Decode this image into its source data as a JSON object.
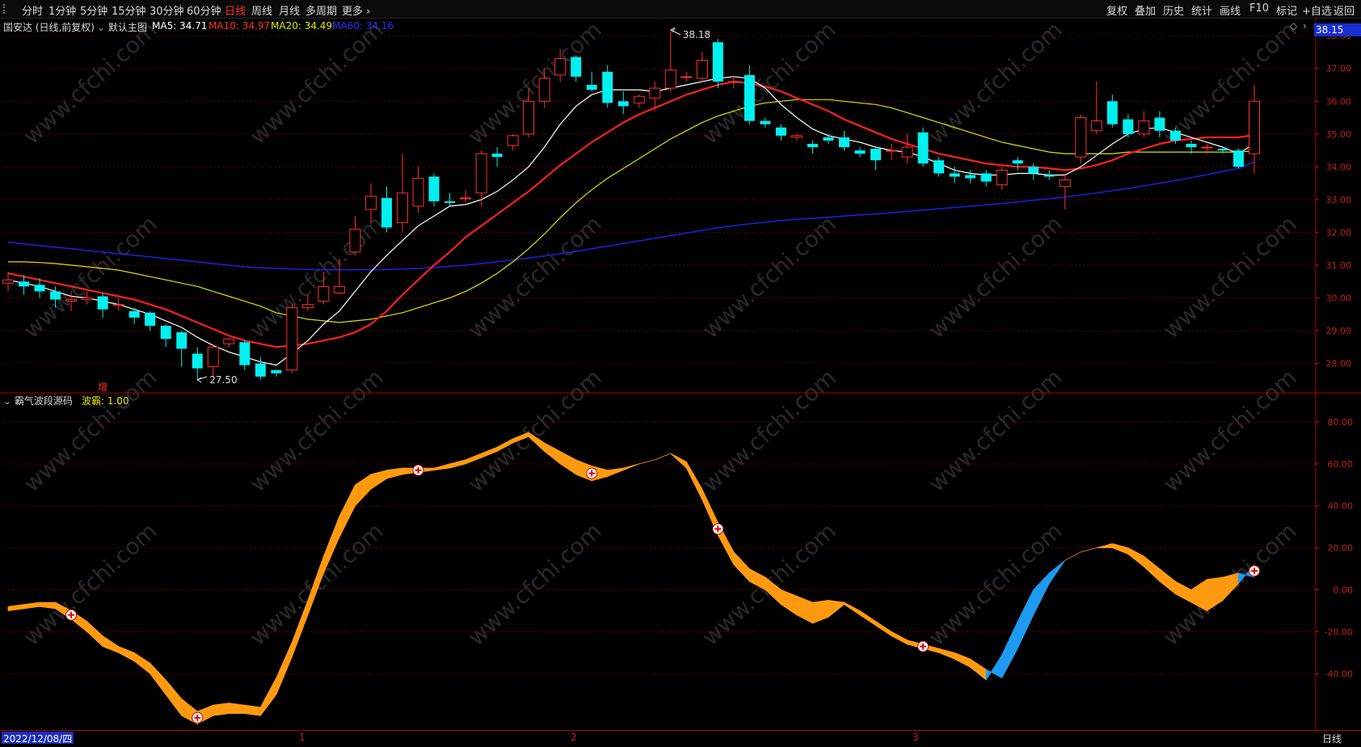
{
  "toolbar": {
    "periods": [
      "分时",
      "1分钟",
      "5分钟",
      "15分钟",
      "30分钟",
      "60分钟",
      "日线",
      "周线",
      "月线",
      "多周期",
      "更多 ›"
    ],
    "active_period": "日线",
    "right_buttons": [
      "复权",
      "叠加",
      "历史",
      "统计",
      "画线",
      "F10",
      "标记",
      "+自选",
      "返回"
    ]
  },
  "main_chart": {
    "title": "国安达 (日线,前复权)",
    "template": "默认主图",
    "ma_labels": [
      {
        "text": "MA5: 34.71",
        "color": "#ffffff"
      },
      {
        "text": "MA10: 34.97",
        "color": "#ff3030"
      },
      {
        "text": "MA20: 34.49",
        "color": "#e8e800"
      },
      {
        "text": "MA60: 34.16",
        "color": "#3030ff"
      }
    ],
    "current_price": "38.15",
    "high_mark": "38.18",
    "low_mark": "27.50",
    "marker_char": "增",
    "yaxis_ticks": [
      "38.00",
      "37.00",
      "36.00",
      "35.00",
      "34.00",
      "33.00",
      "32.00",
      "31.00",
      "30.00",
      "29.00",
      "28.00"
    ]
  },
  "sub_chart": {
    "title": "霸气波段源码",
    "value_label": "波霸: 1.00",
    "yaxis_ticks": [
      "80.00",
      "60.00",
      "40.00",
      "20.00",
      "0.00",
      "-20.00",
      "-40.00"
    ]
  },
  "bottom": {
    "date": "2022/12/08/四",
    "months": [
      "1",
      "2",
      "3"
    ],
    "period": "日线"
  },
  "watermark": "www.cfchi.com",
  "colors": {
    "up": "#ff3030",
    "down": "#00f0f0",
    "ma5": "#ffffff",
    "ma10": "#ff2020",
    "ma20": "#e0e000",
    "ma60": "#2020e0",
    "osc_up": "#ff9a10",
    "osc_down": "#1e9af0",
    "grid": "#6a0000",
    "axis": "#c02020"
  },
  "chart_data": {
    "type": "candlestick",
    "ylim": [
      27.3,
      38.3
    ],
    "candles": [
      [
        30.45,
        30.55,
        30.2,
        30.8
      ],
      [
        30.5,
        30.35,
        30.1,
        30.7
      ],
      [
        30.4,
        30.2,
        30.0,
        30.6
      ],
      [
        30.2,
        29.95,
        29.7,
        30.35
      ],
      [
        29.9,
        29.95,
        29.6,
        30.2
      ],
      [
        29.95,
        30.0,
        29.8,
        30.2
      ],
      [
        30.05,
        29.65,
        29.4,
        30.15
      ],
      [
        29.8,
        29.8,
        29.6,
        30.0
      ],
      [
        29.6,
        29.4,
        29.2,
        29.7
      ],
      [
        29.55,
        29.15,
        29.0,
        29.6
      ],
      [
        29.15,
        28.75,
        28.5,
        29.2
      ],
      [
        28.95,
        28.45,
        27.9,
        29.0
      ],
      [
        28.3,
        27.85,
        27.5,
        28.5
      ],
      [
        27.9,
        28.5,
        27.6,
        28.6
      ],
      [
        28.6,
        28.75,
        28.5,
        28.8
      ],
      [
        28.65,
        27.95,
        27.8,
        28.7
      ],
      [
        28.0,
        27.6,
        27.5,
        28.2
      ],
      [
        27.8,
        27.7,
        27.6,
        27.8
      ],
      [
        27.8,
        29.7,
        27.7,
        29.8
      ],
      [
        29.7,
        29.8,
        29.6,
        30.1
      ],
      [
        29.9,
        30.35,
        29.8,
        30.8
      ],
      [
        30.15,
        30.35,
        30.1,
        31.2
      ],
      [
        31.4,
        32.1,
        31.3,
        32.5
      ],
      [
        32.7,
        33.1,
        32.3,
        33.5
      ],
      [
        33.05,
        32.15,
        32.0,
        33.4
      ],
      [
        32.3,
        33.2,
        32.0,
        34.4
      ],
      [
        32.8,
        33.65,
        32.6,
        34.0
      ],
      [
        33.7,
        32.95,
        32.8,
        33.8
      ],
      [
        32.95,
        32.9,
        32.8,
        33.2
      ],
      [
        33.05,
        33.05,
        32.9,
        33.3
      ],
      [
        33.2,
        34.4,
        32.8,
        34.5
      ],
      [
        34.4,
        34.3,
        34.0,
        34.6
      ],
      [
        34.65,
        34.95,
        34.5,
        35.0
      ],
      [
        35.0,
        36.0,
        34.9,
        36.4
      ],
      [
        36.0,
        36.7,
        35.8,
        37.0
      ],
      [
        36.8,
        37.3,
        36.6,
        37.6
      ],
      [
        37.35,
        36.75,
        36.6,
        37.4
      ],
      [
        36.5,
        36.35,
        36.3,
        36.9
      ],
      [
        36.9,
        35.95,
        35.8,
        37.1
      ],
      [
        36.0,
        35.85,
        35.6,
        36.3
      ],
      [
        35.95,
        36.15,
        35.8,
        36.2
      ],
      [
        36.1,
        36.4,
        35.7,
        36.6
      ],
      [
        36.4,
        36.95,
        36.3,
        38.18
      ],
      [
        36.75,
        36.75,
        36.6,
        36.9
      ],
      [
        36.7,
        37.25,
        36.6,
        37.5
      ],
      [
        37.8,
        36.6,
        36.4,
        37.9
      ],
      [
        36.6,
        36.6,
        36.4,
        36.8
      ],
      [
        36.8,
        35.4,
        35.3,
        37.1
      ],
      [
        35.4,
        35.3,
        35.2,
        35.5
      ],
      [
        35.2,
        34.95,
        34.8,
        35.3
      ],
      [
        34.9,
        34.95,
        34.8,
        35.0
      ],
      [
        34.7,
        34.6,
        34.4,
        34.8
      ],
      [
        34.9,
        34.8,
        34.7,
        35.0
      ],
      [
        34.9,
        34.6,
        34.5,
        35.1
      ],
      [
        34.5,
        34.4,
        34.3,
        34.6
      ],
      [
        34.55,
        34.2,
        33.9,
        34.6
      ],
      [
        34.5,
        34.5,
        34.2,
        34.7
      ],
      [
        34.3,
        34.6,
        34.1,
        35.0
      ],
      [
        35.05,
        34.1,
        34.0,
        35.2
      ],
      [
        34.2,
        33.8,
        33.7,
        34.3
      ],
      [
        33.8,
        33.7,
        33.5,
        34.0
      ],
      [
        33.75,
        33.65,
        33.5,
        33.9
      ],
      [
        33.8,
        33.55,
        33.4,
        33.9
      ],
      [
        33.45,
        33.9,
        33.3,
        34.0
      ],
      [
        34.2,
        34.1,
        33.9,
        34.3
      ],
      [
        34.0,
        33.8,
        33.6,
        34.1
      ],
      [
        33.75,
        33.7,
        33.6,
        33.9
      ],
      [
        33.4,
        33.6,
        32.7,
        33.8
      ],
      [
        34.3,
        35.5,
        34.1,
        35.6
      ],
      [
        35.1,
        35.4,
        35.0,
        36.6
      ],
      [
        36.0,
        35.3,
        35.2,
        36.2
      ],
      [
        35.45,
        35.0,
        34.9,
        35.6
      ],
      [
        35.0,
        35.4,
        34.9,
        35.7
      ],
      [
        35.5,
        35.1,
        34.9,
        35.7
      ],
      [
        35.1,
        34.8,
        34.7,
        35.2
      ],
      [
        34.7,
        34.6,
        34.4,
        34.8
      ],
      [
        34.6,
        34.6,
        34.4,
        34.7
      ],
      [
        34.55,
        34.5,
        34.4,
        34.6
      ],
      [
        34.5,
        34.0,
        33.95,
        34.55
      ],
      [
        34.4,
        36.0,
        33.8,
        36.5
      ]
    ],
    "ma5": [
      30.55,
      30.45,
      30.35,
      30.2,
      30.05,
      30.0,
      29.9,
      29.8,
      29.65,
      29.5,
      29.3,
      29.1,
      28.8,
      28.55,
      28.35,
      28.2,
      28.05,
      27.95,
      28.3,
      28.7,
      29.2,
      29.6,
      30.2,
      30.8,
      31.3,
      31.75,
      32.2,
      32.5,
      32.8,
      32.85,
      33.0,
      33.25,
      33.6,
      34.0,
      34.6,
      35.3,
      35.85,
      36.2,
      36.35,
      36.35,
      36.35,
      36.3,
      36.4,
      36.5,
      36.6,
      36.7,
      36.75,
      36.7,
      36.4,
      35.9,
      35.5,
      35.15,
      34.95,
      34.85,
      34.75,
      34.6,
      34.5,
      34.45,
      34.3,
      34.1,
      33.9,
      33.8,
      33.75,
      33.75,
      33.8,
      33.8,
      33.75,
      33.75,
      34.0,
      34.35,
      34.7,
      35.0,
      35.15,
      35.2,
      35.05,
      34.9,
      34.75,
      34.6,
      34.4,
      34.71
    ],
    "ma10": [
      30.75,
      30.65,
      30.55,
      30.45,
      30.35,
      30.25,
      30.15,
      30.05,
      29.95,
      29.8,
      29.65,
      29.45,
      29.25,
      29.05,
      28.85,
      28.7,
      28.6,
      28.5,
      28.55,
      28.6,
      28.7,
      28.8,
      28.95,
      29.2,
      29.6,
      30.1,
      30.55,
      31.0,
      31.4,
      31.85,
      32.2,
      32.55,
      32.9,
      33.25,
      33.65,
      34.05,
      34.4,
      34.75,
      35.05,
      35.35,
      35.6,
      35.8,
      36.0,
      36.2,
      36.35,
      36.5,
      36.6,
      36.55,
      36.45,
      36.3,
      36.1,
      35.9,
      35.7,
      35.45,
      35.25,
      35.05,
      34.85,
      34.7,
      34.55,
      34.4,
      34.3,
      34.2,
      34.1,
      34.05,
      34.0,
      34.0,
      33.95,
      33.9,
      33.95,
      34.05,
      34.2,
      34.4,
      34.55,
      34.7,
      34.8,
      34.85,
      34.9,
      34.9,
      34.9,
      34.97
    ],
    "ma20": [
      31.1,
      31.1,
      31.08,
      31.05,
      31.0,
      30.95,
      30.9,
      30.85,
      30.75,
      30.65,
      30.55,
      30.45,
      30.35,
      30.2,
      30.05,
      29.9,
      29.75,
      29.55,
      29.45,
      29.35,
      29.3,
      29.25,
      29.3,
      29.35,
      29.45,
      29.55,
      29.7,
      29.85,
      30.0,
      30.2,
      30.45,
      30.75,
      31.1,
      31.5,
      31.95,
      32.45,
      32.9,
      33.3,
      33.65,
      33.95,
      34.25,
      34.55,
      34.85,
      35.1,
      35.35,
      35.55,
      35.7,
      35.85,
      35.95,
      36.0,
      36.05,
      36.05,
      36.05,
      36.0,
      35.95,
      35.9,
      35.8,
      35.65,
      35.5,
      35.35,
      35.2,
      35.05,
      34.9,
      34.75,
      34.65,
      34.55,
      34.45,
      34.4,
      34.4,
      34.4,
      34.4,
      34.45,
      34.45,
      34.45,
      34.45,
      34.45,
      34.45,
      34.45,
      34.45,
      34.49
    ],
    "ma60": [
      31.7,
      31.65,
      31.6,
      31.55,
      31.5,
      31.45,
      31.4,
      31.35,
      31.3,
      31.25,
      31.2,
      31.15,
      31.1,
      31.05,
      31.0,
      30.95,
      30.92,
      30.9,
      30.88,
      30.87,
      30.86,
      30.86,
      30.86,
      30.86,
      30.87,
      30.88,
      30.9,
      30.93,
      30.96,
      31.0,
      31.05,
      31.1,
      31.16,
      31.22,
      31.28,
      31.35,
      31.42,
      31.5,
      31.58,
      31.66,
      31.74,
      31.82,
      31.9,
      31.98,
      32.06,
      32.14,
      32.2,
      32.26,
      32.31,
      32.36,
      32.4,
      32.43,
      32.46,
      32.5,
      32.53,
      32.56,
      32.6,
      32.64,
      32.68,
      32.72,
      32.76,
      32.8,
      32.84,
      32.88,
      32.93,
      32.98,
      33.03,
      33.08,
      33.14,
      33.2,
      33.27,
      33.34,
      33.42,
      33.5,
      33.58,
      33.67,
      33.76,
      33.86,
      33.95,
      34.16
    ],
    "oscillator": {
      "ylim": [
        -63,
        90
      ],
      "line1": [
        -8,
        -7,
        -6,
        -6,
        -10,
        -15,
        -22,
        -27,
        -30,
        -35,
        -43,
        -52,
        -58,
        -55,
        -54,
        -55,
        -56,
        -42,
        -25,
        -5,
        16,
        35,
        50,
        55,
        57,
        58,
        58,
        58,
        60,
        62,
        65,
        68,
        72,
        75,
        70,
        66,
        62,
        59,
        57,
        58,
        60,
        62,
        65,
        61,
        48,
        32,
        18,
        10,
        6,
        0,
        -3,
        -6,
        -5,
        -6,
        -10,
        -15,
        -20,
        -24,
        -26,
        -28,
        -30,
        -33,
        -38,
        -42,
        -28,
        -12,
        3,
        14,
        18,
        20,
        22,
        20,
        16,
        10,
        4,
        0,
        5,
        6,
        8,
        6
      ],
      "line2": [
        -10,
        -9,
        -8,
        -9,
        -14,
        -20,
        -27,
        -30,
        -34,
        -40,
        -50,
        -60,
        -64,
        -60,
        -59,
        -59,
        -60,
        -50,
        -32,
        -12,
        8,
        25,
        40,
        48,
        53,
        55,
        56,
        57,
        58,
        60,
        63,
        66,
        70,
        73,
        66,
        60,
        55,
        52,
        54,
        57,
        60,
        62,
        65,
        58,
        43,
        26,
        12,
        4,
        0,
        -7,
        -12,
        -16,
        -13,
        -7,
        -12,
        -17,
        -22,
        -26,
        -28,
        -30,
        -33,
        -37,
        -43,
        -31,
        -15,
        0,
        8,
        14,
        18,
        20,
        20,
        17,
        11,
        4,
        -2,
        -6,
        -10,
        -5,
        3,
        12
      ],
      "markers": [
        4,
        12,
        26,
        37,
        45,
        58,
        79
      ]
    }
  }
}
